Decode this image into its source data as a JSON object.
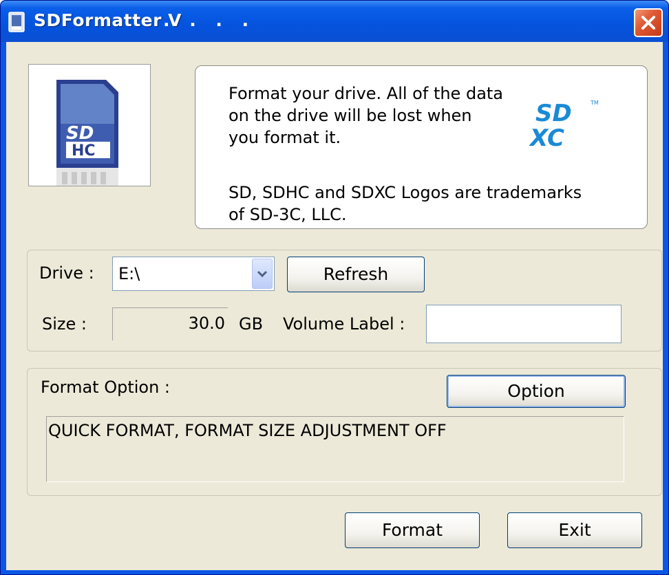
{
  "window": {
    "title": "SDFormatter V",
    "title_suffix": ". . . ."
  },
  "info": {
    "message": "Format your drive. All of the data\non the drive will be lost when\nyou format it.",
    "trademark": "SD, SDHC and SDXC Logos are trademarks\nof SD-3C, LLC."
  },
  "logos": {
    "sdhc_card": {
      "top_text": "SD",
      "bottom_text": "HC"
    },
    "sdxc": {
      "top_text": "SD",
      "bottom_text": "XC",
      "tm": "TM",
      "color": "#1a8ad6"
    }
  },
  "drive": {
    "label": "Drive :",
    "selected": "E:\\",
    "refresh_label": "Refresh",
    "size_label": "Size  :",
    "size_value": "30.0",
    "size_unit": "GB",
    "volume_label_text": "Volume Label  :",
    "volume_label_value": ""
  },
  "format_option": {
    "label": "Format Option :",
    "option_button": "Option",
    "current": "QUICK FORMAT, FORMAT SIZE ADJUSTMENT OFF"
  },
  "actions": {
    "format_label": "Format",
    "exit_label": "Exit"
  },
  "colors": {
    "title_bar": "#0553dd",
    "client_bg": "#ece9d8",
    "close_button": "#e05a36",
    "sdhc_card": "#2a3f8f"
  }
}
